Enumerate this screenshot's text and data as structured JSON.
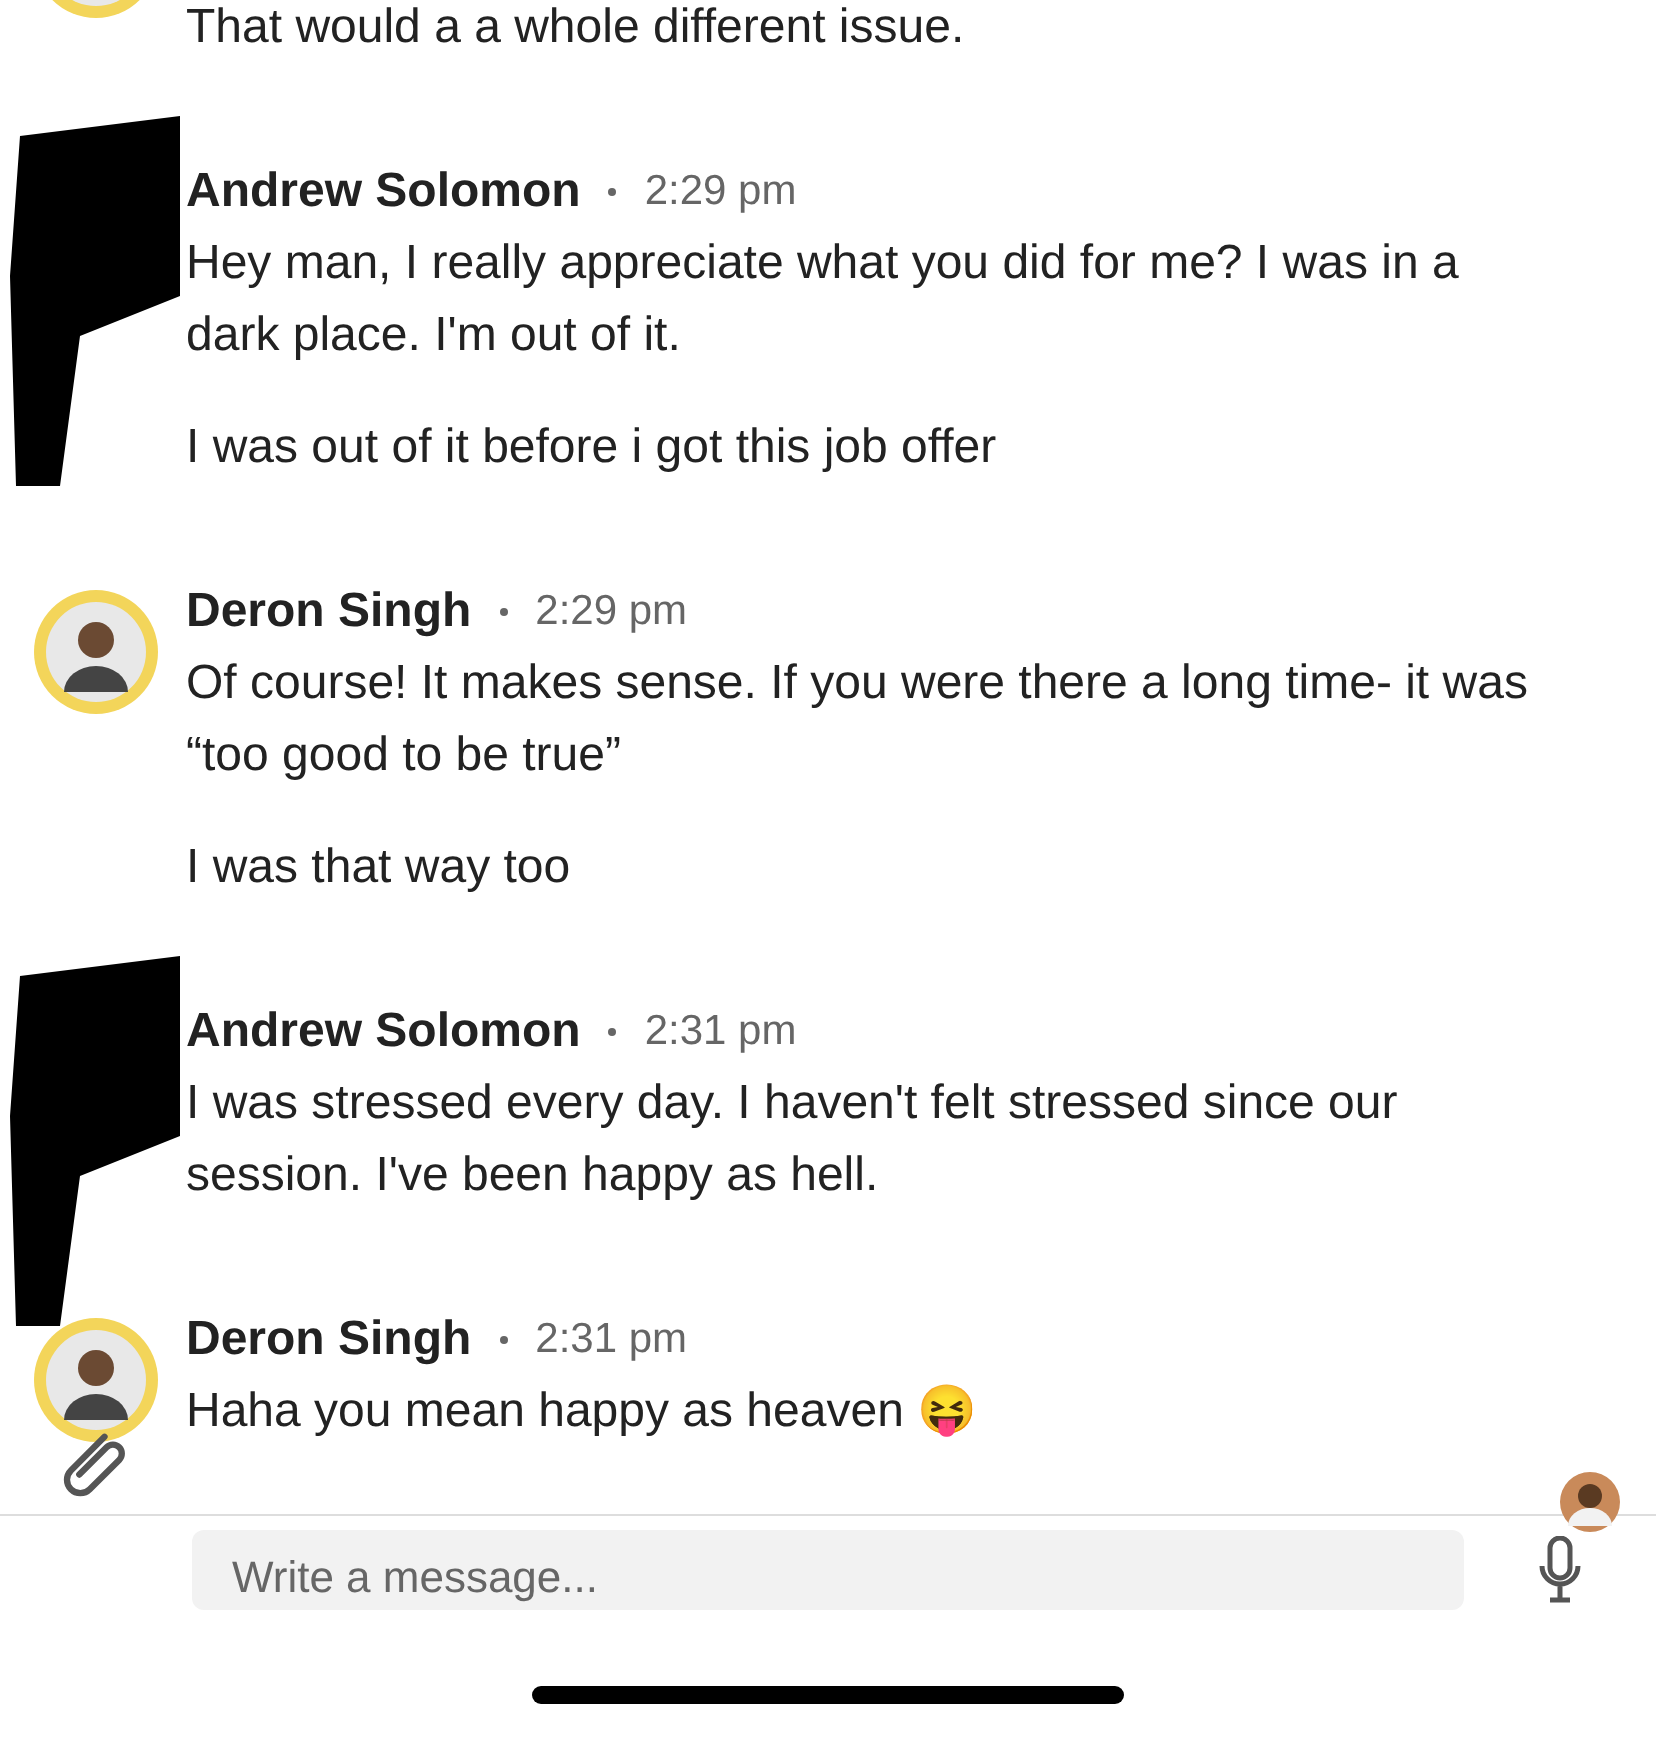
{
  "messages": [
    {
      "kind": "normal",
      "paragraphs": [
        "That would a a whole different issue."
      ]
    },
    {
      "kind": "redacted",
      "sender": "Andrew Solomon",
      "time": "2:29 pm",
      "paragraphs": [
        "Hey man, I really appreciate what you did for me? I was in a dark place. I'm out of it.",
        "I was out of it before i got this job offer"
      ]
    },
    {
      "kind": "normal",
      "sender": "Deron Singh",
      "time": "2:29 pm",
      "paragraphs": [
        "Of course! It makes sense. If you were there a long time- it was “too good to be true”",
        "I was that way too"
      ]
    },
    {
      "kind": "redacted",
      "sender": "Andrew Solomon",
      "time": "2:31 pm",
      "paragraphs": [
        "I was stressed every day. I haven't felt stressed since our session. I've been happy as hell."
      ]
    },
    {
      "kind": "normal",
      "sender": "Deron Singh",
      "time": "2:31 pm",
      "paragraphs": [
        "Haha you mean happy as heaven 😝"
      ]
    }
  ],
  "composer": {
    "placeholder": "Write a message..."
  }
}
